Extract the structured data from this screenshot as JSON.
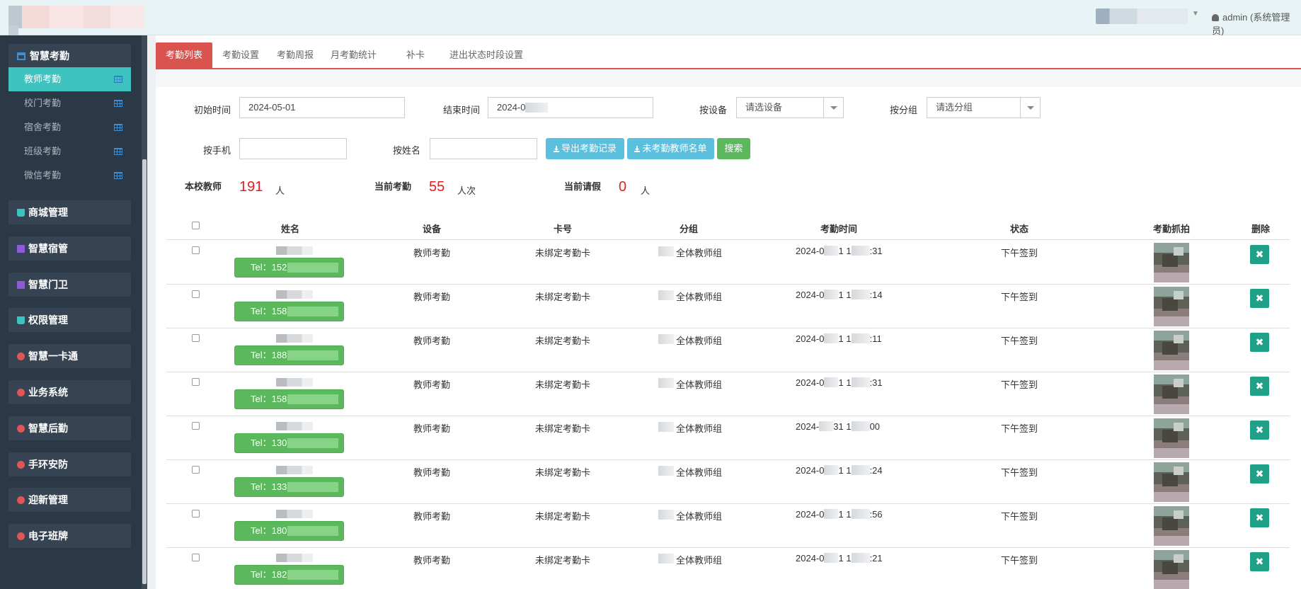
{
  "header": {
    "admin_label": "admin (系统管理员)"
  },
  "sidebar": {
    "group_title": "智慧考勤",
    "sub_items": [
      {
        "label": "教师考勤",
        "active": true
      },
      {
        "label": "校门考勤",
        "active": false
      },
      {
        "label": "宿舍考勤",
        "active": false
      },
      {
        "label": "班级考勤",
        "active": false
      },
      {
        "label": "微信考勤",
        "active": false
      }
    ],
    "menus": [
      {
        "label": "商城管理",
        "icon": "cart-icon",
        "color": "#3fc3c0"
      },
      {
        "label": "智慧宿管",
        "icon": "list-icon",
        "color": "#8e5bd6"
      },
      {
        "label": "智慧门卫",
        "icon": "list-icon",
        "color": "#8e5bd6"
      },
      {
        "label": "权限管理",
        "icon": "cart-icon",
        "color": "#3fc3c0"
      },
      {
        "label": "智慧一卡通",
        "icon": "gear-icon",
        "color": "#e05555"
      },
      {
        "label": "业务系统",
        "icon": "gear-icon",
        "color": "#e05555"
      },
      {
        "label": "智慧后勤",
        "icon": "gear-icon",
        "color": "#e05555"
      },
      {
        "label": "手环安防",
        "icon": "gear-icon",
        "color": "#e05555"
      },
      {
        "label": "迎新管理",
        "icon": "gear-icon",
        "color": "#e05555"
      },
      {
        "label": "电子班牌",
        "icon": "gear-icon",
        "color": "#e05555"
      }
    ]
  },
  "tabs": [
    "考勤列表",
    "考勤设置",
    "考勤周报",
    "月考勤统计",
    "补卡",
    "进出状态时段设置"
  ],
  "filters": {
    "start_label": "初始时间",
    "start_value": "2024-05-01",
    "end_label": "结束时间",
    "end_value": "2024-0",
    "device_label": "按设备",
    "device_value": "请选设备",
    "group_label": "按分组",
    "group_value": "请选分组",
    "phone_label": "按手机",
    "name_label": "按姓名",
    "export_btn": "导出考勤记录",
    "absent_btn": "未考勤教师名单",
    "search_btn": "搜索"
  },
  "stats": {
    "teachers_label": "本校教师",
    "teachers_value": "191",
    "teachers_unit": "人",
    "attend_label": "当前考勤",
    "attend_value": "55",
    "attend_unit": "人次",
    "leave_label": "当前请假",
    "leave_value": "0",
    "leave_unit": "人"
  },
  "table": {
    "headers": [
      "姓名",
      "设备",
      "卡号",
      "分组",
      "考勤时间",
      "状态",
      "考勤抓拍",
      "删除"
    ],
    "rows": [
      {
        "tel": "Tel：152",
        "device": "教师考勤",
        "card": "未绑定考勤卡",
        "group": "全体教师组",
        "time_a": "2024-0",
        "time_b": "1 1",
        "time_c": ":31",
        "status": "下午签到"
      },
      {
        "tel": "Tel：158",
        "device": "教师考勤",
        "card": "未绑定考勤卡",
        "group": "全体教师组",
        "time_a": "2024-0",
        "time_b": "1 1",
        "time_c": ":14",
        "status": "下午签到"
      },
      {
        "tel": "Tel：188",
        "device": "教师考勤",
        "card": "未绑定考勤卡",
        "group": "全体教师组",
        "time_a": "2024-0",
        "time_b": "1 1",
        "time_c": ":11",
        "status": "下午签到"
      },
      {
        "tel": "Tel：158",
        "device": "教师考勤",
        "card": "未绑定考勤卡",
        "group": "全体教师组",
        "time_a": "2024-0",
        "time_b": "1 1",
        "time_c": ":31",
        "status": "下午签到"
      },
      {
        "tel": "Tel：130",
        "device": "教师考勤",
        "card": "未绑定考勤卡",
        "group": "全体教师组",
        "time_a": "2024-",
        "time_b": "31 1",
        "time_c": "00",
        "status": "下午签到"
      },
      {
        "tel": "Tel：133",
        "device": "教师考勤",
        "card": "未绑定考勤卡",
        "group": "全体教师组",
        "time_a": "2024-0",
        "time_b": "1 1",
        "time_c": ":24",
        "status": "下午签到"
      },
      {
        "tel": "Tel：180",
        "device": "教师考勤",
        "card": "未绑定考勤卡",
        "group": "全体教师组",
        "time_a": "2024-0",
        "time_b": "1 1",
        "time_c": ":56",
        "status": "下午签到"
      },
      {
        "tel": "Tel：182",
        "device": "教师考勤",
        "card": "未绑定考勤卡",
        "group": "全体教师组",
        "time_a": "2024-0",
        "time_b": "1 1",
        "time_c": ":21",
        "status": "下午签到"
      }
    ],
    "delete_glyph": "✖"
  }
}
